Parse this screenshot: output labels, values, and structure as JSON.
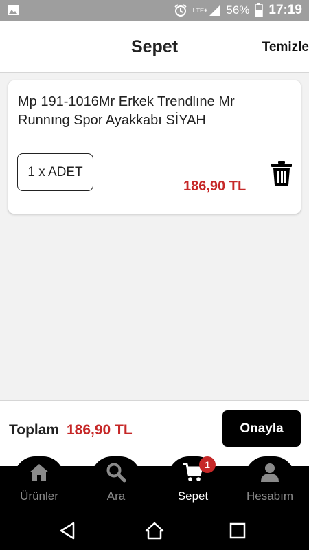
{
  "status_bar": {
    "network": "LTE+",
    "battery": "56%",
    "time": "17:19",
    "icons": [
      "image-icon",
      "alarm-icon",
      "signal-icon",
      "battery-icon"
    ]
  },
  "header": {
    "title": "Sepet",
    "clear_label": "Temizle"
  },
  "cart": {
    "items": [
      {
        "title": "Mp 191-1016Mr Erkek Trendlıne Mr Runnıng Spor Ayakkabı SİYAH",
        "quantity_label": "1 x ADET",
        "price": "186,90 TL",
        "delete_icon": "trash-icon"
      }
    ]
  },
  "summary": {
    "total_label": "Toplam",
    "total_value": "186,90 TL",
    "confirm_label": "Onayla"
  },
  "bottom_nav": {
    "items": [
      {
        "label": "Ürünler",
        "icon": "home-icon"
      },
      {
        "label": "Ara",
        "icon": "search-icon"
      },
      {
        "label": "Sepet",
        "icon": "cart-icon",
        "badge": "1",
        "active": true
      },
      {
        "label": "Hesabım",
        "icon": "user-icon"
      }
    ]
  },
  "colors": {
    "accent": "#c62828",
    "nav_bg": "#000000",
    "status_bar_bg": "#9e9e9e"
  }
}
